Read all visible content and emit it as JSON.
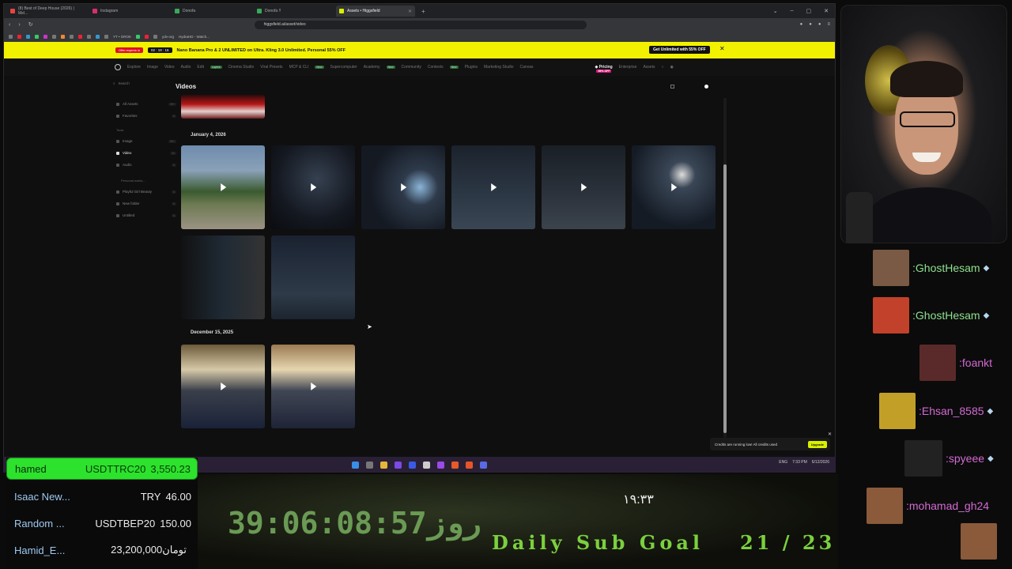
{
  "browser": {
    "tabs": [
      {
        "label": "(8) Best of Deep House (2026) | Mel..."
      },
      {
        "label": "Instagram"
      },
      {
        "label": "Donofa"
      },
      {
        "label": "Donofa !!"
      },
      {
        "label": "Assets • Higgsfield"
      }
    ],
    "url": "higgsfield.ai/asset/video",
    "bookmarks": [
      "YT • GROK",
      "ydv-org",
      "HydraHD - Watch..."
    ]
  },
  "promo": {
    "badge": "Offer expires in",
    "timer": "02 : 19 : 16",
    "message": "Nano Banana Pro & 2 UNLIMITED on Ultra. Kling 3.0 Unlimited. Personal 55% OFF",
    "cta": "Get Unlimited with 55% OFF",
    "close": "✕"
  },
  "nav": {
    "items": [
      "Explore",
      "Image",
      "Video",
      "Audio",
      "Edit",
      "Cinema Studio",
      "Viral Presets",
      "MCP & CLI",
      "Supercomputer",
      "Academy",
      "Community",
      "Contests",
      "Plugins",
      "Marketing Studio",
      "Canvas"
    ],
    "new_badge": "New",
    "layers_badge": "Layers",
    "pricing": "Pricing",
    "pricing_tag": "55% OFF",
    "enterprise": "Enterprise",
    "assets": "Assets"
  },
  "sidebar": {
    "search_placeholder": "Search",
    "items": [
      {
        "label": "All Assets",
        "count": "99+"
      },
      {
        "label": "Favorites",
        "count": "0"
      }
    ],
    "tools_label": "Tools",
    "tools": [
      {
        "label": "Image",
        "count": "99+"
      },
      {
        "label": "Video",
        "count": "11"
      },
      {
        "label": "Audio",
        "count": "0"
      }
    ],
    "workspace_label": "Personal works...",
    "folders": [
      {
        "label": "Playful Girl Beauty",
        "count": "0"
      },
      {
        "label": "New folder",
        "count": "0"
      },
      {
        "label": "Untitled",
        "count": "0"
      }
    ]
  },
  "page": {
    "title": "Videos",
    "groups": [
      {
        "date": "January 4, 2026"
      },
      {
        "date": "December 15, 2025"
      }
    ]
  },
  "toast": {
    "message": "Credits are running low! All credits used",
    "button": "Upgrade",
    "close": "✕"
  },
  "taskbar": {
    "tray": [
      "ENG",
      "7:33 PM",
      "6/12/2026"
    ]
  },
  "chat": [
    {
      "user": ":GhostHesam",
      "color": "#8fe08f",
      "avatar": "#7a5a44"
    },
    {
      "user": ":GhostHesam",
      "color": "#8fe08f",
      "avatar": "#c2412a"
    },
    {
      "user": ":foankt",
      "color": "#d36ad3",
      "avatar": "#5a2a2a"
    },
    {
      "user": ":Ehsan_8585",
      "color": "#d36ad3",
      "avatar": "#c2a028"
    },
    {
      "user": ":spyeee",
      "color": "#d36ad3",
      "avatar": "#222222"
    },
    {
      "user": ":mohamad_gh24",
      "color": "#d36ad3",
      "avatar": "#8a5a3a"
    }
  ],
  "leaderboard": [
    {
      "name": "hamed",
      "currency": "USDTTRC20",
      "amount": "3,550.23"
    },
    {
      "name": "Isaac New...",
      "currency": "TRY",
      "amount": "46.00"
    },
    {
      "name": "Random ...",
      "currency": "USDTBEP20",
      "amount": "150.00"
    },
    {
      "name": "Hamid_E...",
      "currency": "تومان",
      "amount": "23,200,000"
    }
  ],
  "overlay": {
    "counter": "39:06:08:57",
    "counter_suffix": "روز",
    "clock": "۱۹:۳۳",
    "goal_label": "Daily Sub Goal",
    "goal_value": "21 / 23"
  }
}
